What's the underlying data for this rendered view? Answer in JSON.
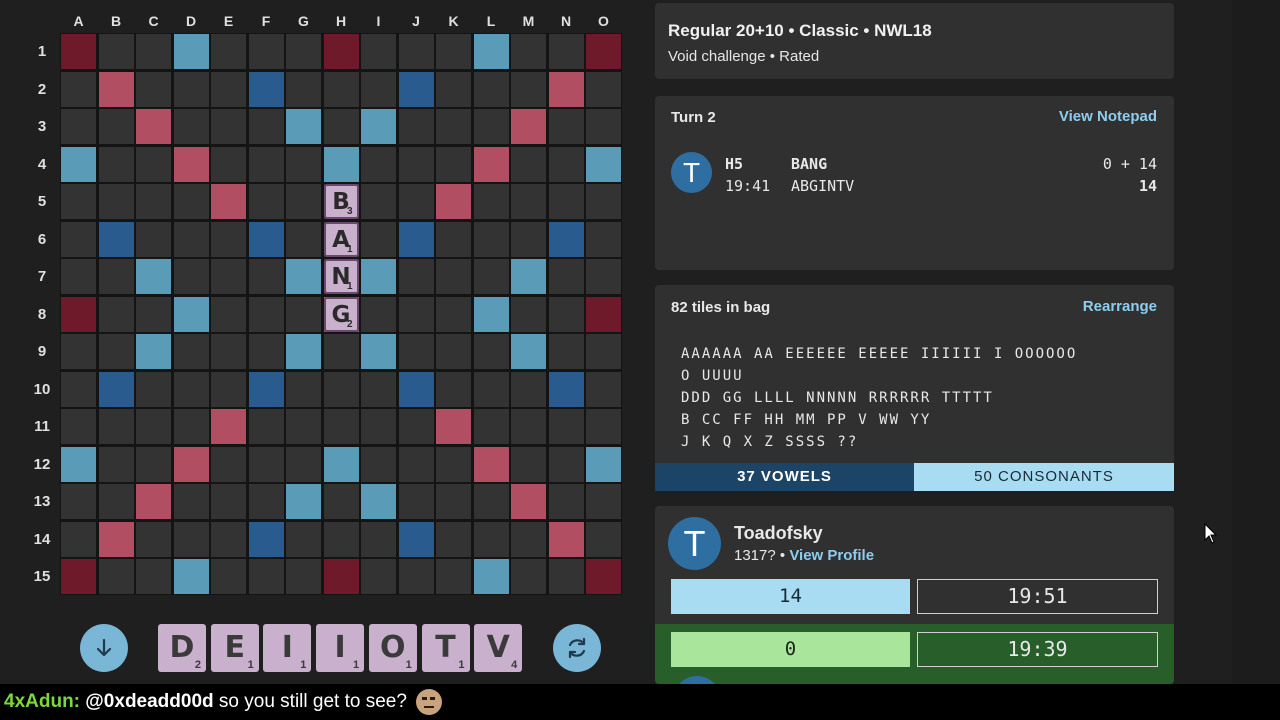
{
  "board": {
    "columns": [
      "A",
      "B",
      "C",
      "D",
      "E",
      "F",
      "G",
      "H",
      "I",
      "J",
      "K",
      "L",
      "M",
      "N",
      "O"
    ],
    "rows": [
      "1",
      "2",
      "3",
      "4",
      "5",
      "6",
      "7",
      "8",
      "9",
      "10",
      "11",
      "12",
      "13",
      "14",
      "15"
    ],
    "premium_layout": [
      "T..d...T...d..T",
      ".D...t...t...D.",
      "..D...d.d...D..",
      "d..D...d...D..d",
      "....D.....D....",
      ".t...t...t...t.",
      "..d...d.d...d..",
      "T..d...D...d..T",
      "..d...d.d...d..",
      ".t...t...t...t.",
      "....D.....D....",
      "d..D...d...D..d",
      "..D...d.d...D..",
      ".D...t...t...D.",
      "T..d...T...d..T"
    ],
    "placed_tiles": [
      {
        "row": 5,
        "col": 8,
        "letter": "B",
        "score": "3"
      },
      {
        "row": 6,
        "col": 8,
        "letter": "A",
        "score": "1"
      },
      {
        "row": 7,
        "col": 8,
        "letter": "N",
        "score": "1"
      },
      {
        "row": 8,
        "col": 8,
        "letter": "G",
        "score": "2"
      }
    ],
    "colors": {
      "tw": "#6e1a2b",
      "dw": "#b24e61",
      "tl": "#2a5b8e",
      "dl": "#5a9bb8",
      "empty": "#333333"
    }
  },
  "rack": {
    "tiles": [
      {
        "letter": "D",
        "score": "2"
      },
      {
        "letter": "E",
        "score": "1"
      },
      {
        "letter": "I",
        "score": "1"
      },
      {
        "letter": "I",
        "score": "1"
      },
      {
        "letter": "O",
        "score": "1"
      },
      {
        "letter": "T",
        "score": "1"
      },
      {
        "letter": "V",
        "score": "4"
      }
    ],
    "left_icon": "arrow-down-icon",
    "right_icon": "refresh-icon"
  },
  "game_info": {
    "title": "Regular 20+10 • Classic • NWL18",
    "subtitle": "Void challenge • Rated"
  },
  "turn_panel": {
    "turn_label": "Turn 2",
    "notepad_link": "View Notepad",
    "move": {
      "avatar_letter": "T",
      "position": "H5",
      "word": "BANG",
      "score_calc": "0 + 14",
      "time": "19:41",
      "rack": "ABGINTV",
      "total": "14"
    }
  },
  "bag_panel": {
    "count_label": "82 tiles in bag",
    "rearrange_link": "Rearrange",
    "lines": [
      "AAAAAA AA EEEEEE EEEEE IIIIII I OOOOOO",
      "O UUUU",
      "DDD GG LLLL NNNNN RRRRRR TTTTT",
      "B CC FF HH MM PP V WW YY",
      "J K Q X Z SSSS ??"
    ],
    "vowels_label": "37 VOWELS",
    "consonants_label": "50 CONSONANTS"
  },
  "player_panel": {
    "avatar_letter": "T",
    "name": "Toadofsky",
    "rating": "1317?",
    "separator": " • ",
    "profile_link": "View Profile",
    "score": "14",
    "clock": "19:51",
    "opponent_score": "0",
    "opponent_clock": "19:39"
  },
  "chat": {
    "user": "4xAdun:",
    "mention": "@0xdeadd00d",
    "message": "so you still get to see?"
  }
}
